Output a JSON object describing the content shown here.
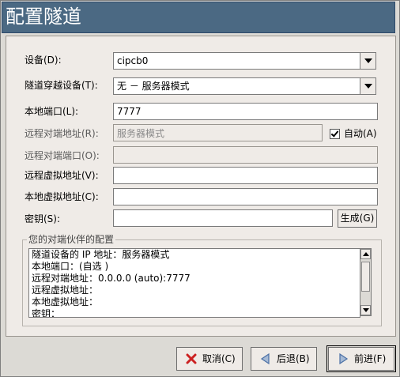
{
  "window": {
    "title": "配置隧道"
  },
  "form": {
    "device_label": "设备(D):",
    "device_value": "cipcb0",
    "tunnel_device_label": "隧道穿越设备(T):",
    "tunnel_device_value": "无 － 服务器模式",
    "local_port_label": "本地端口(L):",
    "local_port_value": "7777",
    "remote_addr_label": "远程对端地址(R):",
    "remote_addr_value": "服务器模式",
    "auto_label": "自动(A)",
    "auto_checked": true,
    "remote_port_label": "远程对端端口(O):",
    "remote_port_value": "",
    "remote_virtual_label": "远程虚拟地址(V):",
    "remote_virtual_value": "",
    "local_virtual_label": "本地虚拟地址(C):",
    "local_virtual_value": "",
    "key_label": "密钥(S):",
    "key_value": "",
    "generate_label": "生成(G)"
  },
  "peer": {
    "title": "您的对端伙伴的配置",
    "lines": [
      "隧道设备的 IP 地址：服务器模式",
      "本地端口：(自选 )",
      "远程对端地址：0.0.0.0 (auto):7777",
      "远程虚拟地址：",
      "本地虚拟地址：",
      "密钥："
    ]
  },
  "buttons": {
    "cancel": "取消(C)",
    "back": "后退(B)",
    "forward": "前进(F)"
  },
  "colors": {
    "titlebar": "#4b6983",
    "cancel_icon": "#cc2222",
    "nav_icon": "#4a6fa5"
  }
}
